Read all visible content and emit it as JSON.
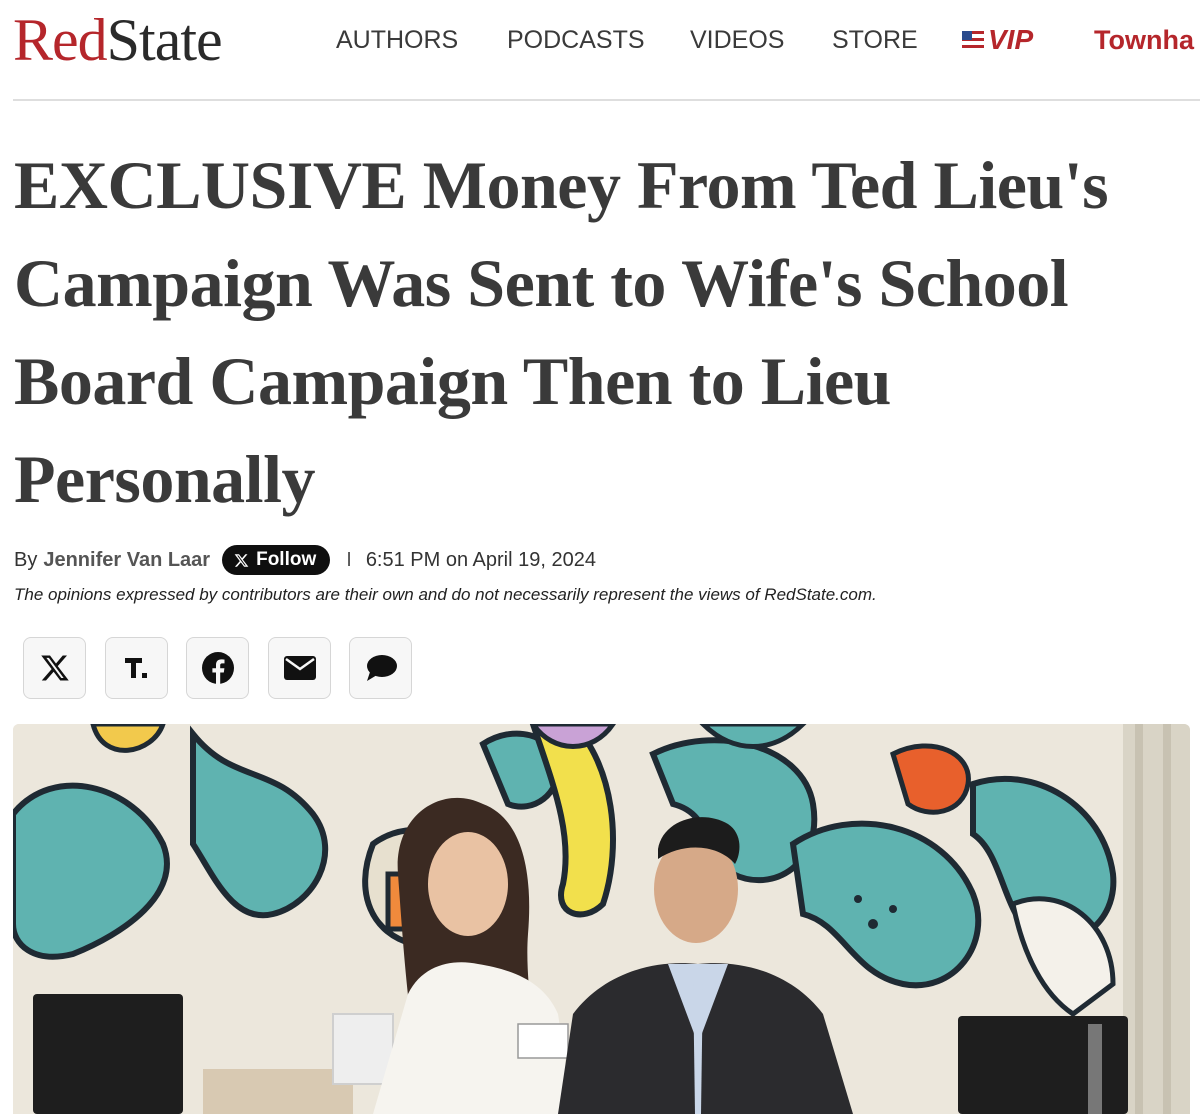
{
  "site": {
    "logo_part1": "Red",
    "logo_part2": "State"
  },
  "nav": {
    "items": [
      {
        "label": "AUTHORS"
      },
      {
        "label": "PODCASTS"
      },
      {
        "label": "VIDEOS"
      },
      {
        "label": "STORE"
      }
    ],
    "vip_label": "VIP",
    "townhall_label": "Townha"
  },
  "article": {
    "headline": "EXCLUSIVE Money From Ted Lieu's Campaign Was Sent to Wife's School Board Campaign Then to Lieu Personally",
    "byline_prefix": "By",
    "author": "Jennifer Van Laar",
    "follow_label": "Follow",
    "separator": "I",
    "timestamp": "6:51 PM on April 19, 2024",
    "disclaimer": "The opinions expressed by contributors are their own and do not necessarily represent the views of RedState.com."
  },
  "share": {
    "buttons": [
      {
        "icon": "x-icon"
      },
      {
        "icon": "townhall-icon"
      },
      {
        "icon": "facebook-icon"
      },
      {
        "icon": "email-icon"
      },
      {
        "icon": "comment-icon"
      }
    ]
  },
  "hero": {
    "image": "photo of a woman in white and a man in a dark suit standing in front of a colorful cartoon mural",
    "colors": {
      "teal": "#5fb3b0",
      "mural_bg": "#ece7dc",
      "outline": "#1f2a33"
    }
  },
  "colors": {
    "brand_red": "#b5262b",
    "headline": "#3a3a3a",
    "follow_bg": "#0f0f0f"
  }
}
